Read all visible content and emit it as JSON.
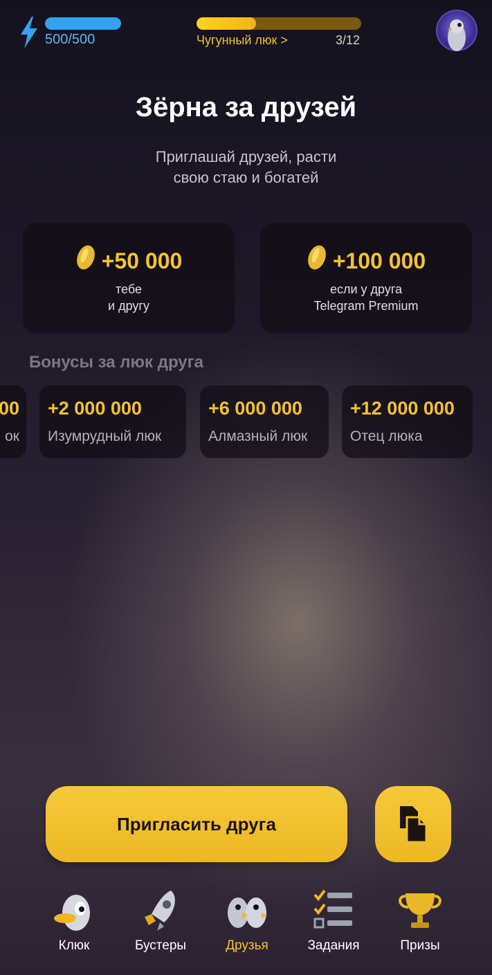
{
  "header": {
    "energy": {
      "text": "500/500",
      "fraction": 1.0
    },
    "level": {
      "name": "Чугунный люк >",
      "count": "3/12",
      "fraction": 0.36
    },
    "avatar_icon": "pigeon-avatar"
  },
  "main": {
    "title": "Зёрна за друзей",
    "subtitle_line1": "Приглашай друзей, расти",
    "subtitle_line2": "свою стаю и богатей",
    "rewards": [
      {
        "amount": "+50 000",
        "desc_line1": "тебе",
        "desc_line2": "и другу",
        "icon": "seed-icon"
      },
      {
        "amount": "+100 000",
        "desc_line1": "если у друга",
        "desc_line2": "Telegram Premium",
        "icon": "seed-icon"
      }
    ],
    "bonus_heading": "Бонусы за люк друга",
    "bonuses": [
      {
        "amount": "00",
        "label": "ок"
      },
      {
        "amount": "+2 000 000",
        "label": "Изумрудный люк"
      },
      {
        "amount": "+6 000 000",
        "label": "Алмазный люк"
      },
      {
        "amount": "+12 000 000",
        "label": "Отец люка"
      }
    ]
  },
  "actions": {
    "invite_label": "Пригласить друга",
    "copy_icon": "copy-icon"
  },
  "nav": [
    {
      "label": "Клюк",
      "icon": "duck-icon"
    },
    {
      "label": "Бустеры",
      "icon": "rocket-icon"
    },
    {
      "label": "Друзья",
      "icon": "friends-icon",
      "active": true
    },
    {
      "label": "Задания",
      "icon": "checklist-icon"
    },
    {
      "label": "Призы",
      "icon": "trophy-icon"
    }
  ],
  "colors": {
    "accent": "#f4c232",
    "energy": "#33a3f0"
  }
}
